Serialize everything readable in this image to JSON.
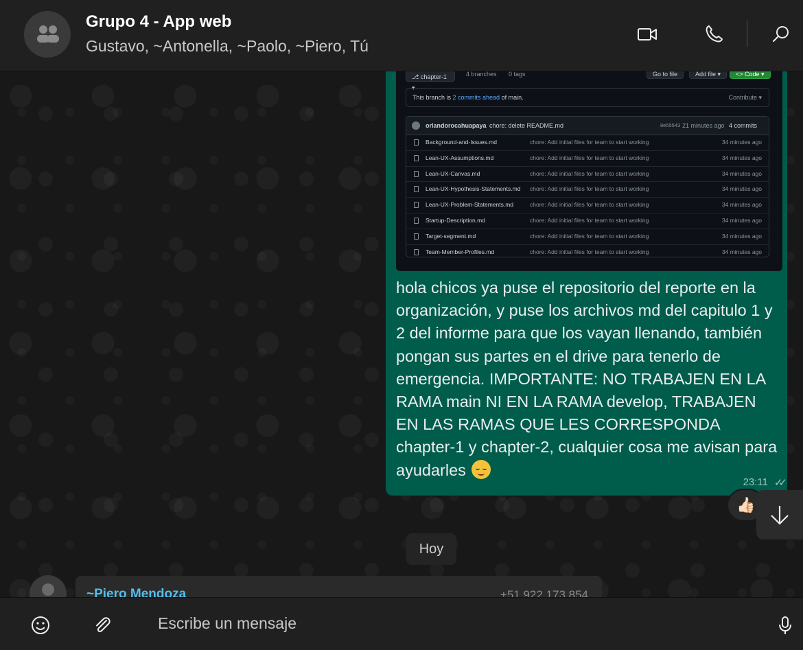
{
  "header": {
    "title": "Grupo 4 - App web",
    "members": "Gustavo, ~Antonella, ~Paolo, ~Piero, Tú",
    "icons": [
      "video-call-icon",
      "voice-call-icon",
      "search-icon"
    ]
  },
  "screenshot": {
    "branch": "chapter-1",
    "branches": "4 branches",
    "tags": "0 tags",
    "go_to_file": "Go to file",
    "add_file": "Add file ▾",
    "code": "<> Code ▾",
    "branch_note_prefix": "This branch is ",
    "branch_note_link": "2 commits ahead",
    "branch_note_suffix": " of main.",
    "contribute": "Contribute ▾",
    "commit_author": "orlandorocahuapaya",
    "commit_message": "chore: delete README.md",
    "commit_hash": "8e55543",
    "commit_time": "21 minutes ago",
    "commit_count": "4 commits",
    "files": [
      {
        "name": "Background-and-Issues.md",
        "msg": "chore: Add initial files for team to start working",
        "time": "34 minutes ago"
      },
      {
        "name": "Lean-UX-Assumptions.md",
        "msg": "chore: Add initial files for team to start working",
        "time": "34 minutes ago"
      },
      {
        "name": "Lean-UX-Canvas.md",
        "msg": "chore: Add initial files for team to start working",
        "time": "34 minutes ago"
      },
      {
        "name": "Lean-UX-Hypothesis-Statements.md",
        "msg": "chore: Add initial files for team to start working",
        "time": "34 minutes ago"
      },
      {
        "name": "Lean-UX-Problem-Statements.md",
        "msg": "chore: Add initial files for team to start working",
        "time": "34 minutes ago"
      },
      {
        "name": "Startup-Description.md",
        "msg": "chore: Add initial files for team to start working",
        "time": "34 minutes ago"
      },
      {
        "name": "Target-segment.md",
        "msg": "chore: Add initial files for team to start working",
        "time": "34 minutes ago"
      },
      {
        "name": "Team-Member-Profiles.md",
        "msg": "chore: Add initial files for team to start working",
        "time": "34 minutes ago"
      }
    ]
  },
  "message": {
    "text": "hola chicos ya puse el repositorio del reporte en la organización, y puse los archivos md del capitulo 1 y 2 del informe para que los vayan llenando, también pongan sus partes en el drive para tenerlo de emergencia. IMPORTANTE: NO TRABAJEN EN LA RAMA main NI EN LA RAMA develop, TRABAJEN EN LAS RAMAS QUE LES CORRESPONDA chapter-1 y chapter-2, cualquier cosa me avisan para ayudarles",
    "emoji": "smiling-face-emoji",
    "time": "23:11",
    "status": "read",
    "reaction": "👍🏻"
  },
  "date_chip": "Hoy",
  "next_message": {
    "sender": "~Piero Mendoza",
    "phone": "+51 922 173 854"
  },
  "composer": {
    "placeholder": "Escribe un mensaje"
  },
  "colors": {
    "outgoing_bubble": "#005c4b",
    "sender_name": "#53bdeb",
    "header_bg": "#202020"
  }
}
